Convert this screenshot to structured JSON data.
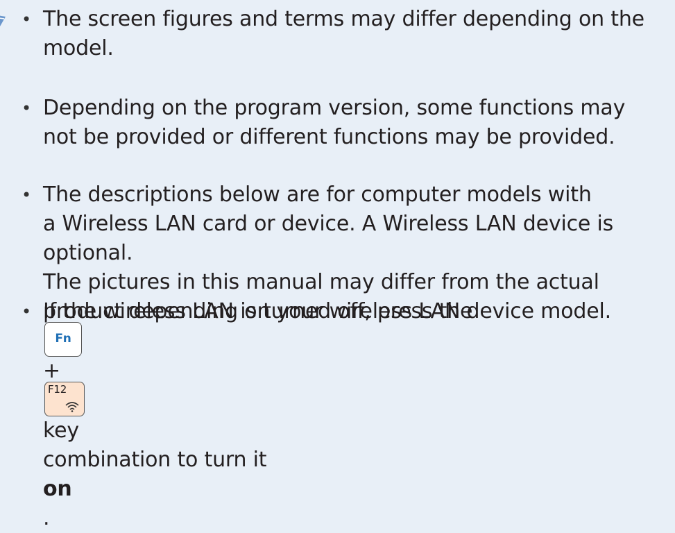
{
  "notes": [
    {
      "lines": [
        "The screen figures and terms may differ depending on the",
        "model."
      ]
    },
    {
      "lines": [
        "Depending on the program version, some functions may",
        "not be provided or different functions may be provided."
      ]
    },
    {
      "lines": [
        "The descriptions below are for computer models with",
        "a Wireless LAN card or device. A Wireless LAN device is",
        "optional.",
        "The pictures in this manual may differ from the actual",
        "product depending on your wireless LAN device model."
      ]
    }
  ],
  "note4": {
    "before": "If the wireless LAN is turned off, press the",
    "plus": "+",
    "after": "key",
    "line2_prefix": "combination to turn it ",
    "line2_bold": "on",
    "line2_suffix": ".",
    "fn_key": "Fn",
    "f12_key": "F12",
    "f12_icon": "wifi-icon"
  },
  "bullet": "•",
  "colors": {
    "background": "#e8eff7",
    "fn_key_text": "#1f6fb5",
    "f12_key_bg": "#fde3cf"
  }
}
